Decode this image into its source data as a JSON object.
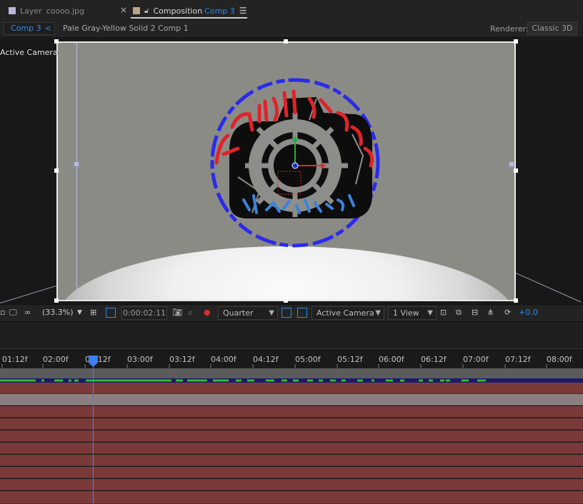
{
  "tabs": {
    "layer_prefix": "Layer",
    "layer_name": "coooo.jpg",
    "close_glyph": "×",
    "comp_prefix": "Composition",
    "comp_name": "Comp 3",
    "menu_glyph": "☰"
  },
  "breadcrumbs": {
    "active": "Comp 3",
    "chevron": "<",
    "second": "Pale Gray-Yellow Solid 2 Comp 1"
  },
  "renderer": {
    "label": "Renderer:",
    "value": "Classic 3D"
  },
  "viewer": {
    "camera_label": "Active Camera"
  },
  "toolbar": {
    "zoom": "(33.3%)",
    "timecode": "0:00:02:11",
    "resolution": "Quarter",
    "view_camera": "Active Camera",
    "view_layout": "1 View",
    "exposure": "+0.0"
  },
  "timeline": {
    "ticks": [
      "01:12f",
      "02:00f",
      "02:12f",
      "03:00f",
      "03:12f",
      "04:00f",
      "04:12f",
      "05:00f",
      "05:12f",
      "06:00f",
      "06:12f",
      "07:00f",
      "07:12f",
      "08:00f"
    ]
  },
  "colors": {
    "accent": "#2d8ceb",
    "track": "#7a3a3a",
    "logo_text": "#e0232a",
    "logo_ring": "#2a2bea",
    "logo_sub": "#3a84dc"
  },
  "icons": [
    "snapshot-icon",
    "show-snapshot-icon",
    "color-channels-icon",
    "region-of-interest-icon",
    "transparency-grid-icon",
    "fast-previews-icon",
    "timeline-icon",
    "flowchart-icon",
    "reset-exposure-icon"
  ]
}
